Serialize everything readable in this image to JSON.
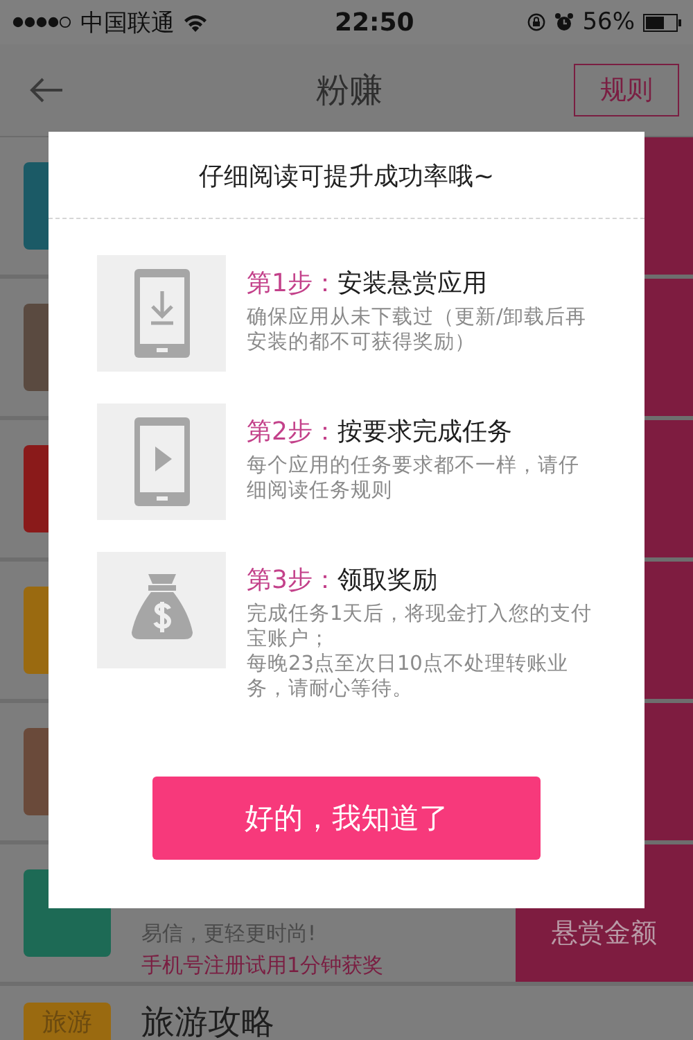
{
  "status_bar": {
    "carrier": "中国联通",
    "time": "22:50",
    "battery": "56%"
  },
  "nav": {
    "title": "粉赚",
    "action": "规则"
  },
  "rows": [
    {
      "color": "#1b5a66"
    },
    {
      "color": "#5a4a40"
    },
    {
      "color": "#8a1a1a"
    },
    {
      "color": "#9a6a10"
    },
    {
      "color": "#6a4a3a"
    },
    {
      "color": "#1d6a55",
      "subtitle": "易信，更轻更时尚!",
      "promo": "手机号注册试用1分钟获奖",
      "label": "悬赏金额"
    },
    {
      "color": "#9a6a10",
      "icon_text": "旅游",
      "name": "旅游攻略"
    }
  ],
  "dialog": {
    "title": "仔细阅读可提升成功率哦~",
    "steps": [
      {
        "kind": "download",
        "label": "第1步：",
        "title": "安装悬赏应用",
        "desc": [
          "确保应用从未下载过（更新/卸载后再安装的都不可获得奖励）"
        ]
      },
      {
        "kind": "play",
        "label": "第2步：",
        "title": "按要求完成任务",
        "desc": [
          "每个应用的任务要求都不一样，请仔细阅读任务规则"
        ]
      },
      {
        "kind": "money",
        "label": "第3步：",
        "title": "领取奖励",
        "desc": [
          "完成任务1天后，将现金打入您的支付宝账户；",
          "每晚23点至次日10点不处理转账业务，请耐心等待。"
        ]
      }
    ],
    "button": "好的，我知道了"
  }
}
